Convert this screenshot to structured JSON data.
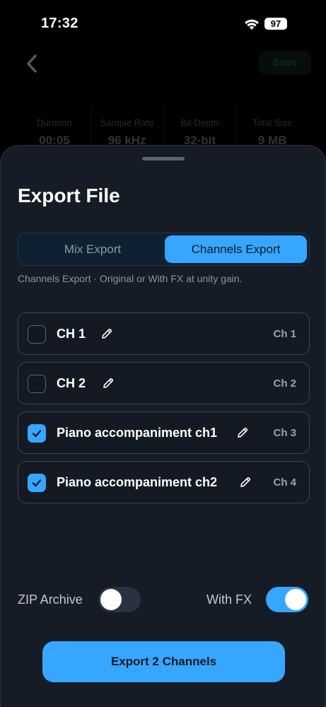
{
  "status_bar": {
    "time": "17:32",
    "battery": "97",
    "wifi_icon": "wifi-icon"
  },
  "background": {
    "save_label": "Save",
    "stats": [
      {
        "label": "Duration",
        "value": "00:05"
      },
      {
        "label": "Sample Rate",
        "value": "96 kHz"
      },
      {
        "label": "Bit Depth",
        "value": "32-bit"
      },
      {
        "label": "Total Size",
        "value": "9 MB"
      }
    ]
  },
  "sheet": {
    "title": "Export File",
    "tabs": [
      {
        "label": "Mix Export",
        "selected": false
      },
      {
        "label": "Channels Export",
        "selected": true
      }
    ],
    "hint": "Channels Export · Original or With FX at unity gain.",
    "channels": [
      {
        "name": "CH 1",
        "tag": "Ch 1",
        "checked": false
      },
      {
        "name": "CH 2",
        "tag": "Ch 2",
        "checked": false
      },
      {
        "name": "Piano accompaniment ch1",
        "tag": "Ch 3",
        "checked": true
      },
      {
        "name": "Piano accompaniment ch2",
        "tag": "Ch 4",
        "checked": true
      }
    ],
    "zip_label": "ZIP Archive",
    "zip_on": false,
    "fx_label": "With FX",
    "fx_on": true,
    "export_button": "Export 2 Channels"
  },
  "colors": {
    "accent": "#37a6ff",
    "sheet_bg": "#161c26"
  }
}
